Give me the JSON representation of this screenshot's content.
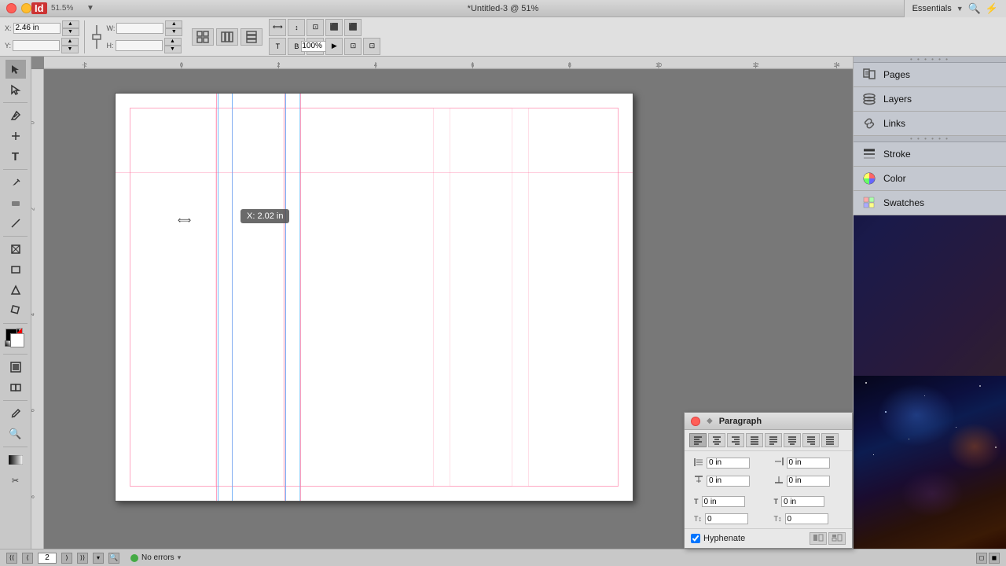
{
  "app": {
    "id_logo": "Id",
    "title": "*Untitled-3 @ 51%",
    "zoom": "51.5%",
    "essentials": "Essentials"
  },
  "window_buttons": {
    "close": "×",
    "minimize": "−",
    "maximize": "+"
  },
  "toolbar": {
    "x_label": "X:",
    "x_value": "2.46 in",
    "y_label": "Y:",
    "y_value": "",
    "w_label": "W:",
    "w_value": "",
    "h_label": "H:",
    "h_value": "",
    "zoom_value": "100%"
  },
  "right_panel": {
    "items": [
      {
        "id": "pages",
        "label": "Pages",
        "icon": "pages"
      },
      {
        "id": "layers",
        "label": "Layers",
        "icon": "layers"
      },
      {
        "id": "links",
        "label": "Links",
        "icon": "links"
      },
      {
        "id": "stroke",
        "label": "Stroke",
        "icon": "stroke"
      },
      {
        "id": "color",
        "label": "Color",
        "icon": "color"
      },
      {
        "id": "swatches",
        "label": "Swatches",
        "icon": "swatches"
      }
    ]
  },
  "paragraph_panel": {
    "title": "Paragraph",
    "align_buttons": [
      {
        "id": "align-left",
        "symbol": "≡"
      },
      {
        "id": "align-center",
        "symbol": "≡"
      },
      {
        "id": "align-right",
        "symbol": "≡"
      },
      {
        "id": "align-justify",
        "symbol": "≡"
      },
      {
        "id": "align-justify-all",
        "symbol": "≡"
      },
      {
        "id": "align-left2",
        "symbol": "≡"
      },
      {
        "id": "align-right2",
        "symbol": "≡"
      },
      {
        "id": "align-justify2",
        "symbol": "≡"
      }
    ],
    "fields": [
      {
        "label": "indent-left",
        "value": "0 in"
      },
      {
        "label": "indent-right",
        "value": "0 in"
      },
      {
        "label": "space-before",
        "value": "0 in"
      },
      {
        "label": "space-after",
        "value": "0 in"
      },
      {
        "label": "drop-cap-lines",
        "value": "0 in"
      },
      {
        "label": "drop-cap-chars",
        "value": "0 in"
      },
      {
        "label": "baseline",
        "value": "0"
      },
      {
        "label": "baseline2",
        "value": "0"
      }
    ],
    "hyphenate_label": "Hyphenate",
    "hyphenate_checked": true,
    "hyp_btn1": "■",
    "hyp_btn2": "■"
  },
  "status_bar": {
    "page_num": "2",
    "no_errors": "No errors"
  },
  "cursor_tooltip": {
    "text": "X: 2.02 in"
  },
  "rulers": {
    "top_marks": [
      "-2",
      "0",
      "2",
      "4",
      "6",
      "8",
      "10",
      "12",
      "14"
    ],
    "left_marks": [
      "0",
      "2",
      "4",
      "6",
      "8"
    ]
  }
}
